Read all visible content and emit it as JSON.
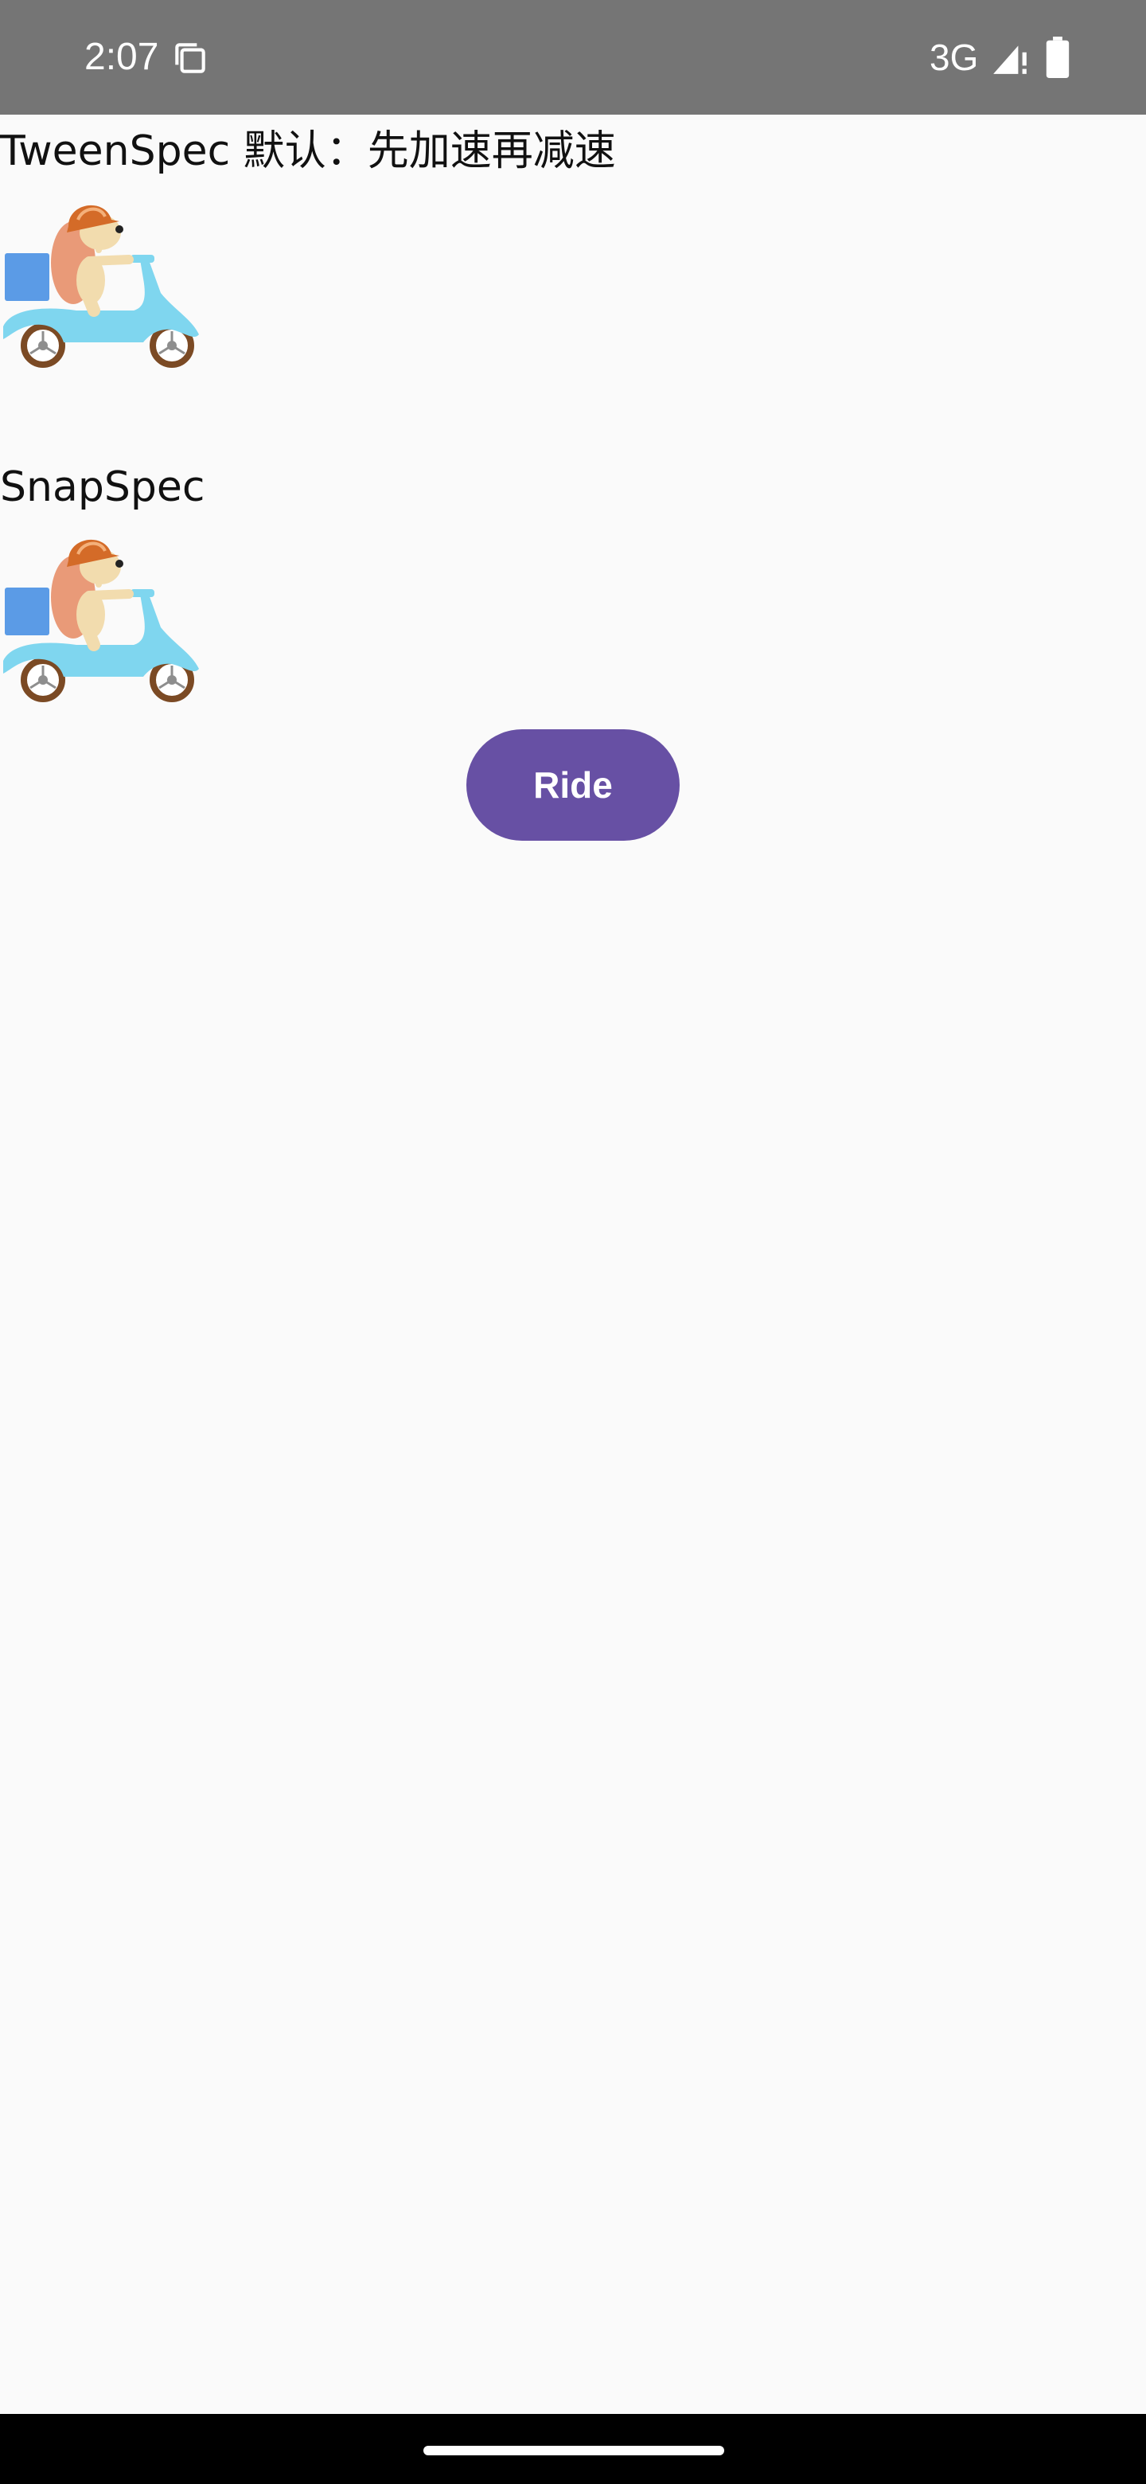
{
  "status_bar": {
    "time": "2:07",
    "network": "3G",
    "icons": [
      "copy-icon",
      "signal-icon",
      "battery-icon"
    ]
  },
  "demos": [
    {
      "label": "TweenSpec 默认：先加速再减速",
      "image": "scooter-rider-icon"
    },
    {
      "label": "SnapSpec",
      "image": "scooter-rider-icon"
    }
  ],
  "ride_button": {
    "label": "Ride",
    "color": "#6750a4"
  },
  "colors": {
    "status_bar": "#757575",
    "background": "#fafafa",
    "nav_bar": "#000000"
  }
}
